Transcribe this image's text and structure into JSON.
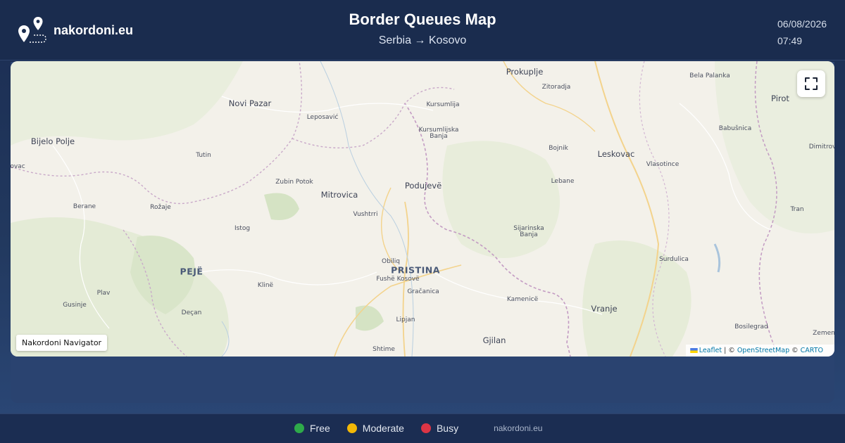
{
  "header": {
    "brand_name": "nakordoni.eu",
    "title": "Border Queues Map",
    "subtitle": "Serbia → Kosovo",
    "date": "06/08/2026",
    "time": "07:49"
  },
  "map": {
    "fullscreen_icon": "fullscreen-icon",
    "navigator_label": "Nakordoni Navigator",
    "attribution": {
      "leaflet": "Leaflet",
      "separator": " | © ",
      "osm": "OpenStreetMap",
      "mid": " © ",
      "carto": "CARTO"
    },
    "places": {
      "prokuplje": "Prokuplje",
      "bela_palanka": "Bela Palanka",
      "zitoradja": "Zitoradja",
      "pirot": "Pirot",
      "novi_pazar": "Novi Pazar",
      "kursumlija": "Kursumlija",
      "leposavic": "Leposavić",
      "kursumlijska_banja_1": "Kursumlijska",
      "kursumlijska_banja_2": "Banja",
      "babusnica": "Babušnica",
      "bijelo_polje": "Bijelo Polje",
      "bojnik": "Bojnik",
      "leskovac": "Leskovac",
      "dimitrovgrad": "Dimitrov",
      "tutin": "Tutin",
      "vlasotince": "Vlasotince",
      "vac": "ovac",
      "zubin_potok": "Zubin Potok",
      "podujeve": "Podujevë",
      "lebane": "Lebane",
      "mitrovica": "Mitrovica",
      "berane": "Berane",
      "rozaje": "Rožaje",
      "vushtrri": "Vushtrri",
      "tran": "Tran",
      "istog": "Istog",
      "sijarinska_1": "Sijarinska",
      "sijarinska_2": "Banja",
      "obiliq": "Obiliq",
      "surdulica": "Surdulica",
      "pristina": "PRISTINA",
      "peje": "PEJË",
      "fushe_kosove": "Fushë Kosovë",
      "kline": "Klinë",
      "gracanica": "Gračanica",
      "plav": "Plav",
      "kamenice": "Kamenicë",
      "gusinje": "Gusinje",
      "vranje": "Vranje",
      "decan": "Deçan",
      "lipjan": "Lipjan",
      "bosilegrad": "Bosilegrad",
      "zemen": "Zemen",
      "gjilan": "Gjilan",
      "shtime": "Shtime"
    }
  },
  "footer": {
    "legend": [
      {
        "label": "Free",
        "color": "#2eaa4a"
      },
      {
        "label": "Moderate",
        "color": "#f2b807"
      },
      {
        "label": "Busy",
        "color": "#dc3545"
      }
    ],
    "site": "nakordoni.eu"
  }
}
